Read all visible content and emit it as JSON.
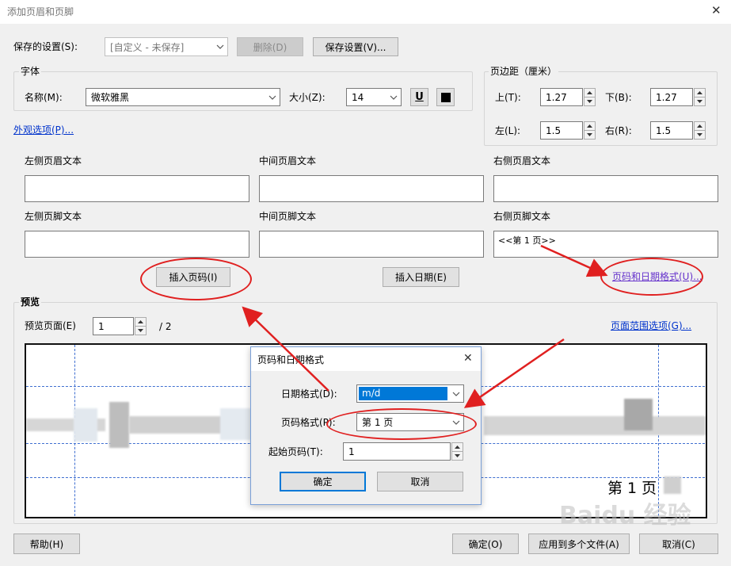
{
  "window": {
    "title": "添加页眉和页脚",
    "close_glyph": "✕"
  },
  "saved_settings": {
    "label": "保存的设置(S):",
    "value": "[自定义 - 未保存]",
    "delete_label": "删除(D)",
    "save_label": "保存设置(V)..."
  },
  "font": {
    "group_label": "字体",
    "name_label": "名称(M):",
    "name_value": "微软雅黑",
    "size_label": "大小(Z):",
    "size_value": "14",
    "underline_glyph": "U"
  },
  "margins": {
    "group_label": "页边距（厘米）",
    "top_label": "上(T):",
    "top_value": "1.27",
    "bottom_label": "下(B):",
    "bottom_value": "1.27",
    "left_label": "左(L):",
    "left_value": "1.5",
    "right_label": "右(R):",
    "right_value": "1.5"
  },
  "appearance_link": "外观选项(P)...",
  "header_fields": {
    "left_label": "左侧页眉文本",
    "center_label": "中间页眉文本",
    "right_label": "右侧页眉文本",
    "left_value": "",
    "center_value": "",
    "right_value": ""
  },
  "footer_fields": {
    "left_label": "左侧页脚文本",
    "center_label": "中间页脚文本",
    "right_label": "右侧页脚文本",
    "left_value": "",
    "center_value": "",
    "right_value": "<<第 1 页>>"
  },
  "insert_page_label": "插入页码(I)",
  "insert_date_label": "插入日期(E)",
  "format_link": "页码和日期格式(U)...",
  "preview": {
    "group_label": "预览",
    "page_label": "预览页面(E)",
    "page_value": "1",
    "page_total": "/ 2",
    "range_link": "页面范围选项(G)...",
    "page_text": "第 1 页"
  },
  "subdialog": {
    "title": "页码和日期格式",
    "close_glyph": "✕",
    "date_label": "日期格式(D):",
    "date_value": "m/d",
    "page_label": "页码格式(P):",
    "page_value": "第 1 页",
    "start_label": "起始页码(T):",
    "start_value": "1",
    "ok_label": "确定",
    "cancel_label": "取消"
  },
  "footer_buttons": {
    "help": "帮助(H)",
    "ok": "确定(O)",
    "apply_multi": "应用到多个文件(A)",
    "cancel": "取消(C)"
  },
  "watermark": "Baidu 经验",
  "colors": {
    "accent": "#0078d7",
    "annotation": "#e02020",
    "selection": "#0078d7",
    "link": "#0033cc"
  }
}
